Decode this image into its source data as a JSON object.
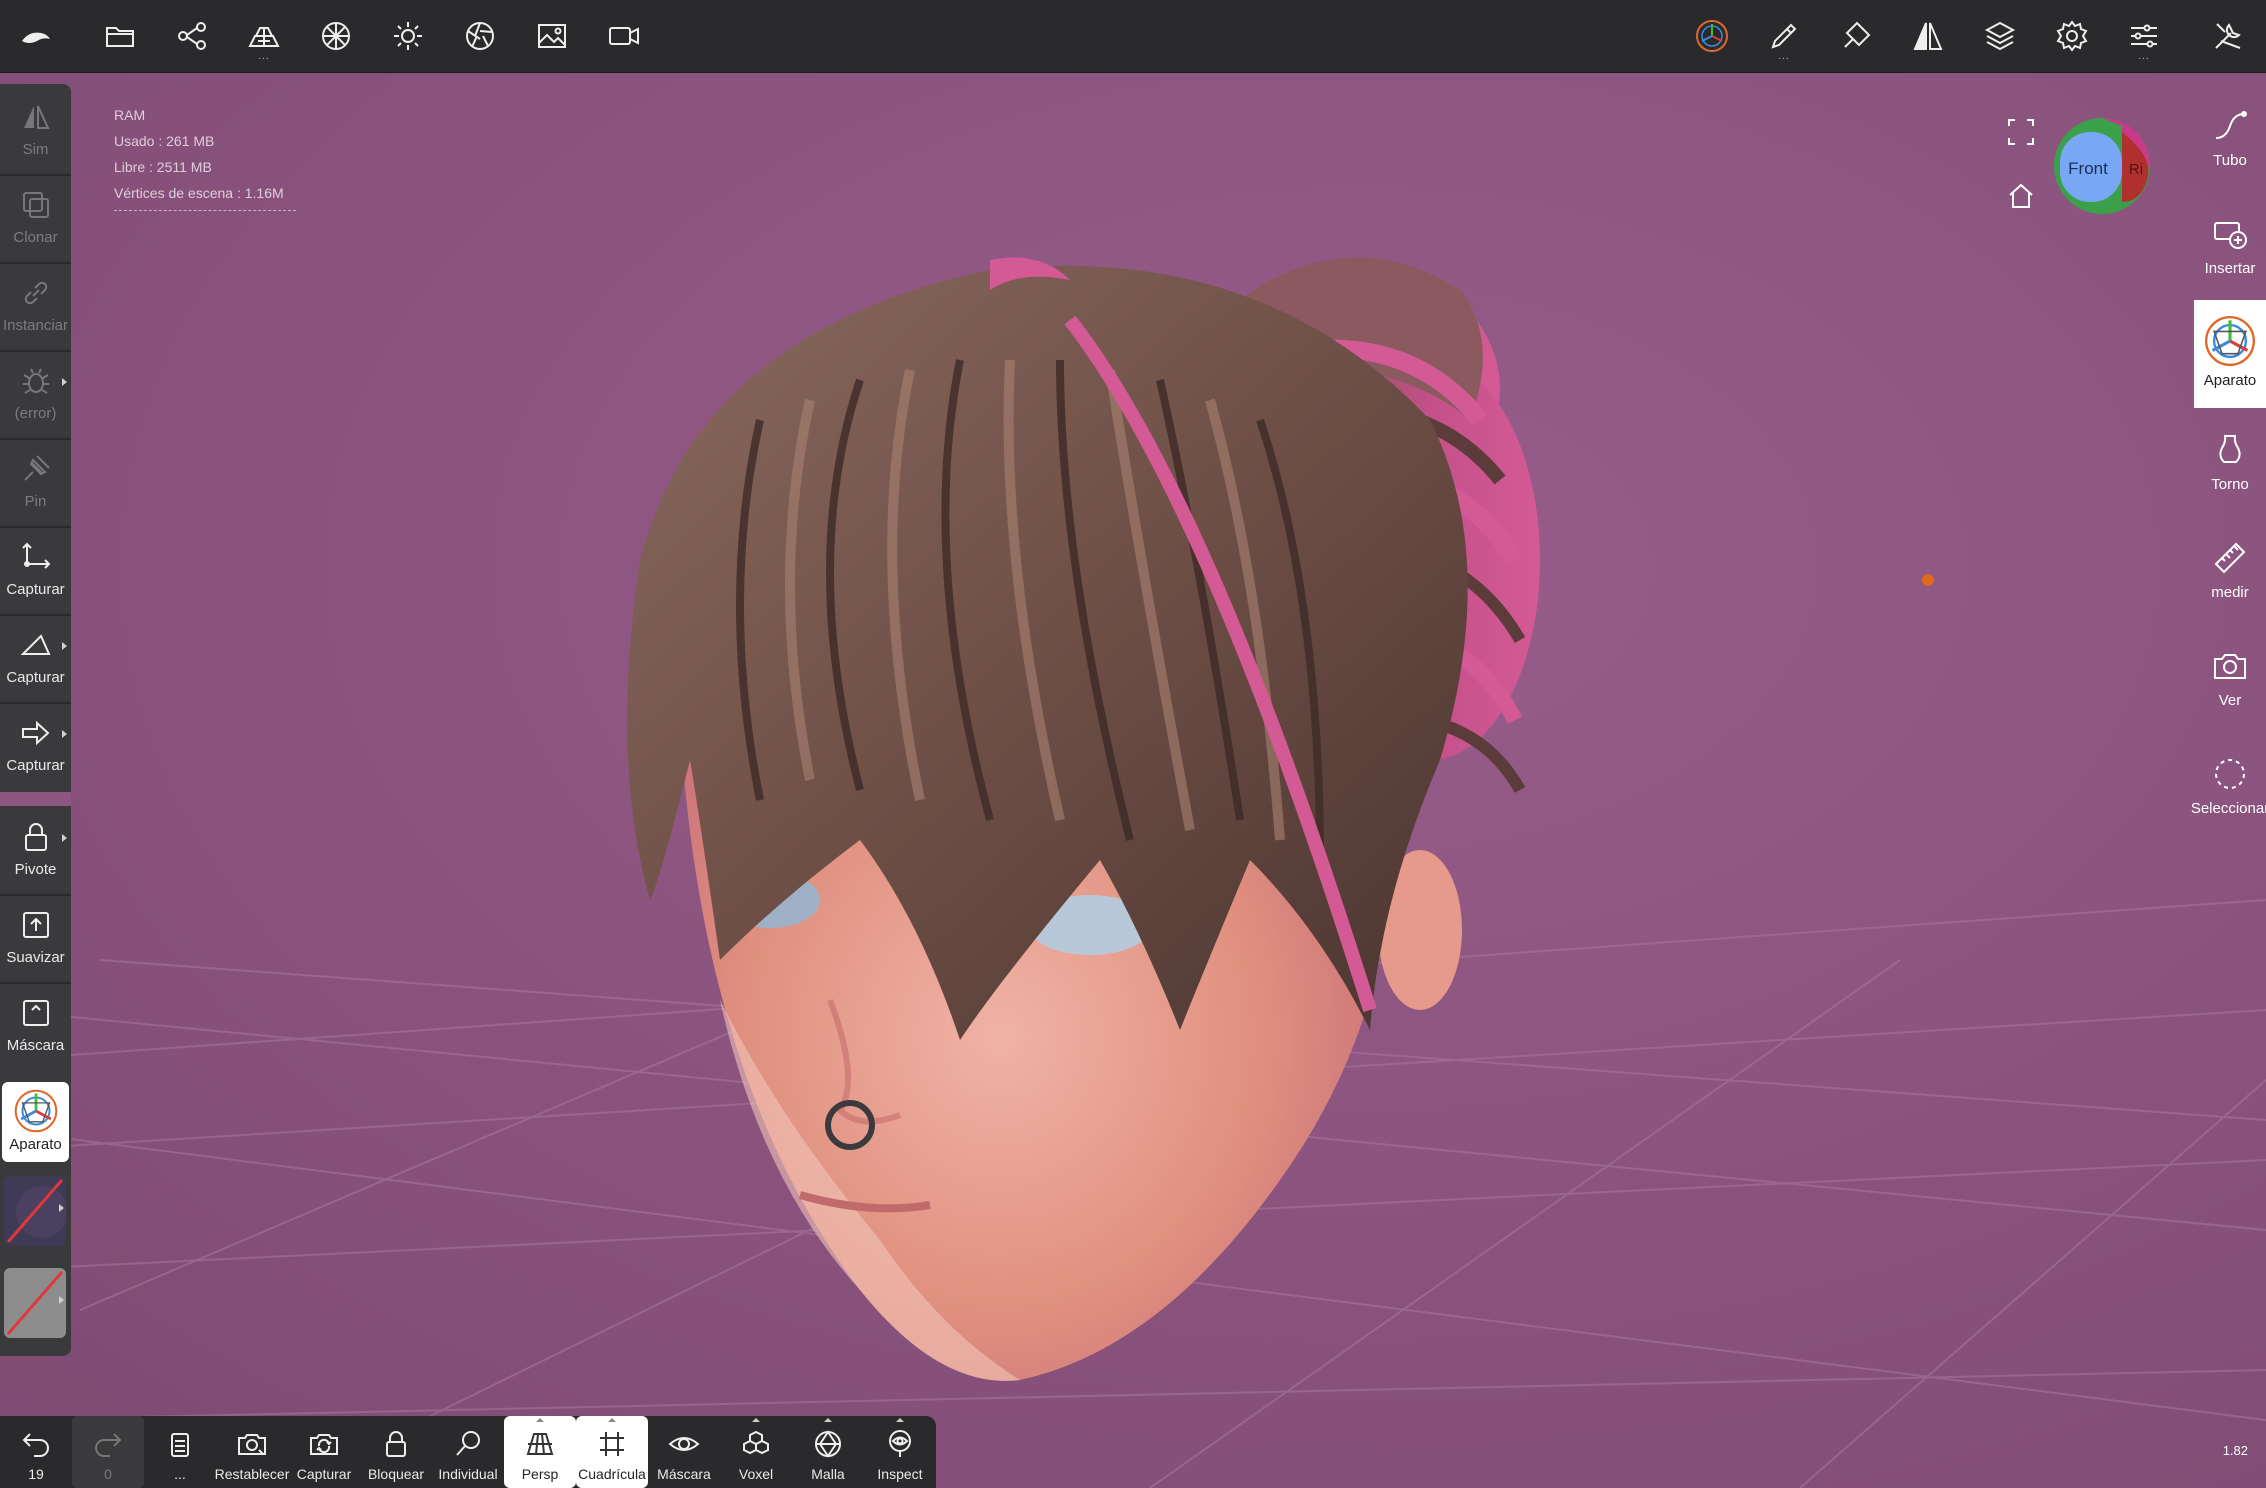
{
  "top_bar": {
    "icons": [
      "app-logo-icon",
      "folder-icon",
      "scene-graph-icon",
      "layers-stack-icon",
      "material-sphere-icon",
      "sun-icon",
      "aperture-icon",
      "image-icon",
      "camera-icon",
      "gizmo-icon",
      "brush-icon",
      "painter-icon",
      "symmetry-icon",
      "layers-icon",
      "settings-icon",
      "sliders-icon",
      "tools-icon"
    ]
  },
  "stats": {
    "heading": "RAM",
    "used": "Usado : 261 MB",
    "free": "Libre : 2511 MB",
    "vertices": "Vértices de escena : 1.16M"
  },
  "left_tools": [
    {
      "label": "Sim",
      "icon": "symmetry-icon",
      "enabled": false
    },
    {
      "label": "Clonar",
      "icon": "clone-icon",
      "enabled": false
    },
    {
      "label": "Instanciar",
      "icon": "link-icon",
      "enabled": false
    },
    {
      "label": "(error)",
      "icon": "bug-icon",
      "enabled": false
    },
    {
      "label": "Pin",
      "icon": "pin-icon",
      "enabled": false
    },
    {
      "label": "Capturar",
      "icon": "snap-axis-icon",
      "enabled": true
    },
    {
      "label": "Capturar",
      "icon": "triangle-icon",
      "enabled": true
    },
    {
      "label": "Capturar",
      "icon": "arrow-right-icon",
      "enabled": true
    },
    {
      "label": "Pivote",
      "icon": "lock-icon",
      "enabled": true
    },
    {
      "label": "Suavizar",
      "icon": "box-up-icon",
      "enabled": true
    },
    {
      "label": "Máscara",
      "icon": "box-caret-icon",
      "enabled": true
    },
    {
      "label": "Aparato",
      "icon": "gizmo-icon",
      "enabled": true,
      "active": true
    }
  ],
  "right_tools": [
    {
      "label": "Tubo",
      "icon": "tube-icon"
    },
    {
      "label": "Insertar",
      "icon": "insert-icon"
    },
    {
      "label": "Aparato",
      "icon": "gizmo-icon",
      "active": true
    },
    {
      "label": "Torno",
      "icon": "lathe-icon"
    },
    {
      "label": "medir",
      "icon": "ruler-icon"
    },
    {
      "label": "Ver",
      "icon": "camera-icon"
    },
    {
      "label": "Seleccionar",
      "icon": "select-lasso-icon"
    }
  ],
  "bottom_bar": [
    {
      "label": "19",
      "icon": "undo-icon"
    },
    {
      "label": "0",
      "icon": "redo-icon",
      "enabled": false
    },
    {
      "label": "...",
      "icon": "document-icon"
    },
    {
      "label": "Restablecer",
      "icon": "reset-camera-icon"
    },
    {
      "label": "Capturar",
      "icon": "capture-icon"
    },
    {
      "label": "Bloquear",
      "icon": "lock-icon"
    },
    {
      "label": "Individual",
      "icon": "search-icon"
    },
    {
      "label": "Persp",
      "icon": "perspective-icon",
      "active": true
    },
    {
      "label": "Cuadrícula",
      "icon": "grid-icon",
      "active": true
    },
    {
      "label": "Máscara",
      "icon": "eye-icon"
    },
    {
      "label": "Voxel",
      "icon": "voxel-icon"
    },
    {
      "label": "Malla",
      "icon": "mesh-sphere-icon"
    },
    {
      "label": "Inspect",
      "icon": "inspect-icon"
    }
  ],
  "view_gizmo": {
    "front": "Front",
    "right": "Ri"
  },
  "zoom": "1.82",
  "colors": {
    "background": "#8d5680",
    "toolbar": "#2a2a2c",
    "hair_pink": "#c74a8a",
    "hair_brown": "#7d5a4f",
    "skin": "#e9a197"
  }
}
